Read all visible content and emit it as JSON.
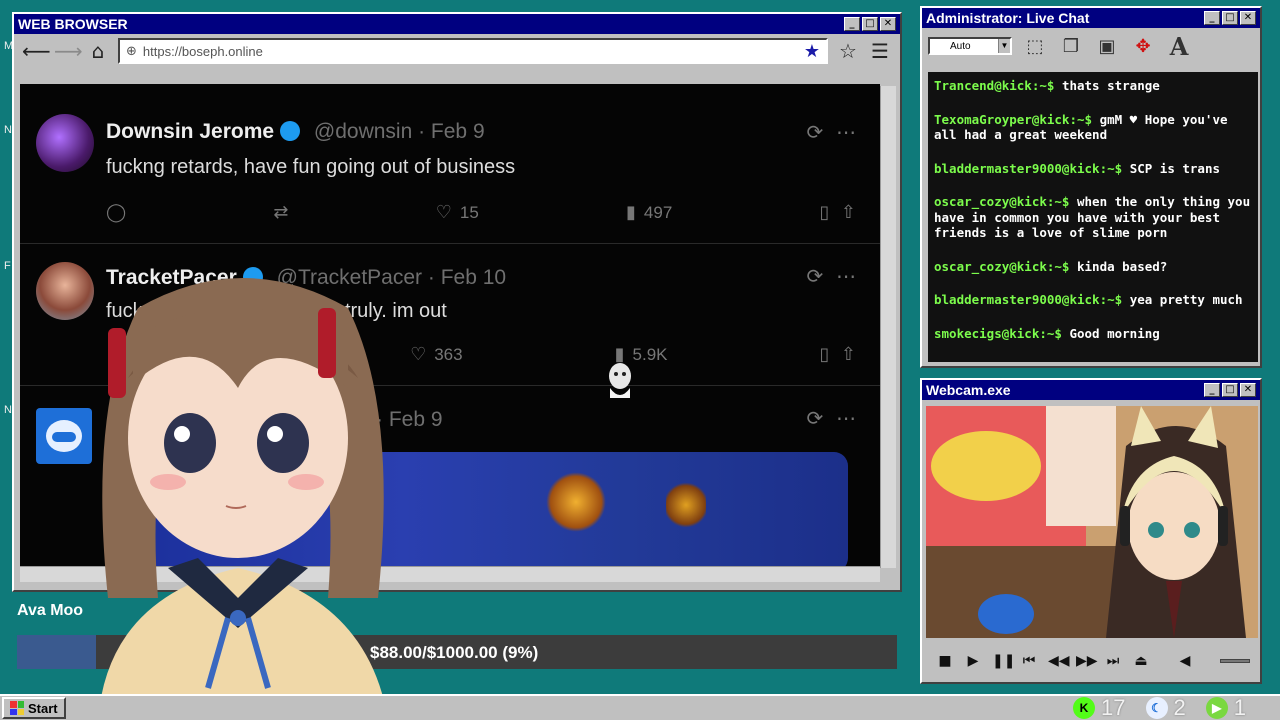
{
  "browser": {
    "title": "WEB BROWSER",
    "url": "https://boseph.online",
    "tweets": [
      {
        "name": "Downsin Jerome",
        "handle": "@downsin · Feb 9",
        "text": "fuckng retards, have fun going out of business",
        "likes": "15",
        "views": "497"
      },
      {
        "name": "TracketPacer",
        "handle": "@TracketPacer · Feb 10",
        "text": "fuck",
        "text2": "uinely & truly. im out",
        "likes": "363",
        "views": "5.9K"
      },
      {
        "handle": "ac · Feb 9"
      }
    ]
  },
  "donation": {
    "label": "Ava Moo",
    "amount": "$88.00/$1000.00 (9%)",
    "progress": 0.09
  },
  "chat": {
    "title": "Administrator: Live Chat",
    "select_value": "Auto",
    "messages": [
      {
        "user": "Trancend@kick:~$",
        "text": "thats strange"
      },
      {
        "user": "TexomaGroyper@kick:~$",
        "text": "gmM ♥ Hope you've all had a great weekend"
      },
      {
        "user": "bladdermaster9000@kick:~$",
        "text": "SCP is trans"
      },
      {
        "user": "oscar_cozy@kick:~$",
        "text": "when the only thing you have in common you have with your best friends is a love of slime porn"
      },
      {
        "user": "oscar_cozy@kick:~$",
        "text": "kinda based?"
      },
      {
        "user": "bladdermaster9000@kick:~$",
        "text": "yea pretty much"
      },
      {
        "user": "smokecigs@kick:~$",
        "text": "Good morning"
      }
    ]
  },
  "webcam": {
    "title": "Webcam.exe"
  },
  "taskbar": {
    "start": "Start",
    "stats": [
      "17",
      "2",
      "1"
    ]
  },
  "colors": {
    "desktop": "#0f7a7a",
    "titlebar": "#000080",
    "chat_user": "#7cfc4c"
  }
}
